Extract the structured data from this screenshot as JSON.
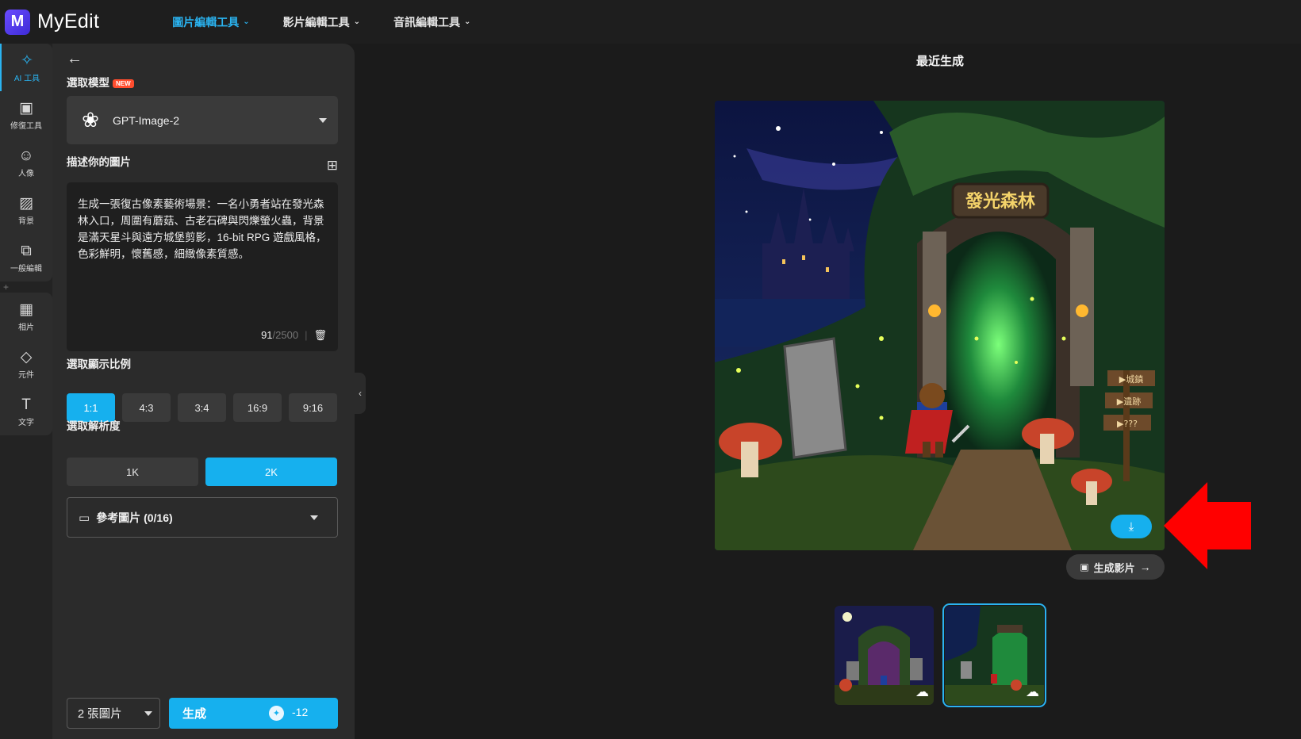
{
  "app": {
    "logo_letter": "M",
    "name": "MyEdit"
  },
  "topnav": [
    {
      "label": "圖片編輯工具",
      "active": true
    },
    {
      "label": "影片編輯工具",
      "active": false
    },
    {
      "label": "音訊編輯工具",
      "active": false
    }
  ],
  "rail": {
    "items": [
      {
        "label": "AI 工具",
        "icon": "magic-wand-icon",
        "glyph": "✧"
      },
      {
        "label": "修復工具",
        "icon": "image-enhance-icon",
        "glyph": "▣"
      },
      {
        "label": "人像",
        "icon": "portrait-icon",
        "glyph": "☺"
      },
      {
        "label": "背景",
        "icon": "background-icon",
        "glyph": "▨"
      },
      {
        "label": "一般編輯",
        "icon": "crop-icon",
        "glyph": "⧉"
      },
      {
        "label": "相片",
        "icon": "photo-icon",
        "glyph": "▦"
      },
      {
        "label": "元件",
        "icon": "shapes-icon",
        "glyph": "◇"
      },
      {
        "label": "文字",
        "icon": "text-icon",
        "glyph": "T"
      }
    ],
    "plus": "+"
  },
  "panel": {
    "model_title": "選取模型",
    "new_badge": "NEW",
    "model_value": "GPT-Image-2",
    "describe_title": "描述你的圖片",
    "prompt": "生成一張復古像素藝術場景：一名小勇者站在發光森林入口，周圍有蘑菇、古老石碑與閃爍螢火蟲，背景是滿天星斗與遠方城堡剪影，16-bit RPG 遊戲風格，色彩鮮明，懷舊感，細緻像素質感。",
    "char_count": "91",
    "char_max": "/2500",
    "char_sep": "|",
    "ratio_title": "選取顯示比例",
    "ratios": [
      "1:1",
      "4:3",
      "3:4",
      "16:9",
      "9:16"
    ],
    "ratio_selected": "1:1",
    "resolution_title": "選取解析度",
    "resolutions": [
      "1K",
      "2K"
    ],
    "resolution_selected": "2K",
    "reference_label": "參考圖片 (0/16)",
    "count_value": "2 張圖片",
    "generate_label": "生成",
    "credit_cost": "-12"
  },
  "main": {
    "title": "最近生成",
    "sign_text": "發光森林",
    "signpost": [
      "▶城鎮",
      "▶遺跡",
      "▶???"
    ],
    "video_button": "生成影片",
    "colors": {
      "accent": "#16b0ee",
      "arrow": "#ff0000"
    }
  }
}
